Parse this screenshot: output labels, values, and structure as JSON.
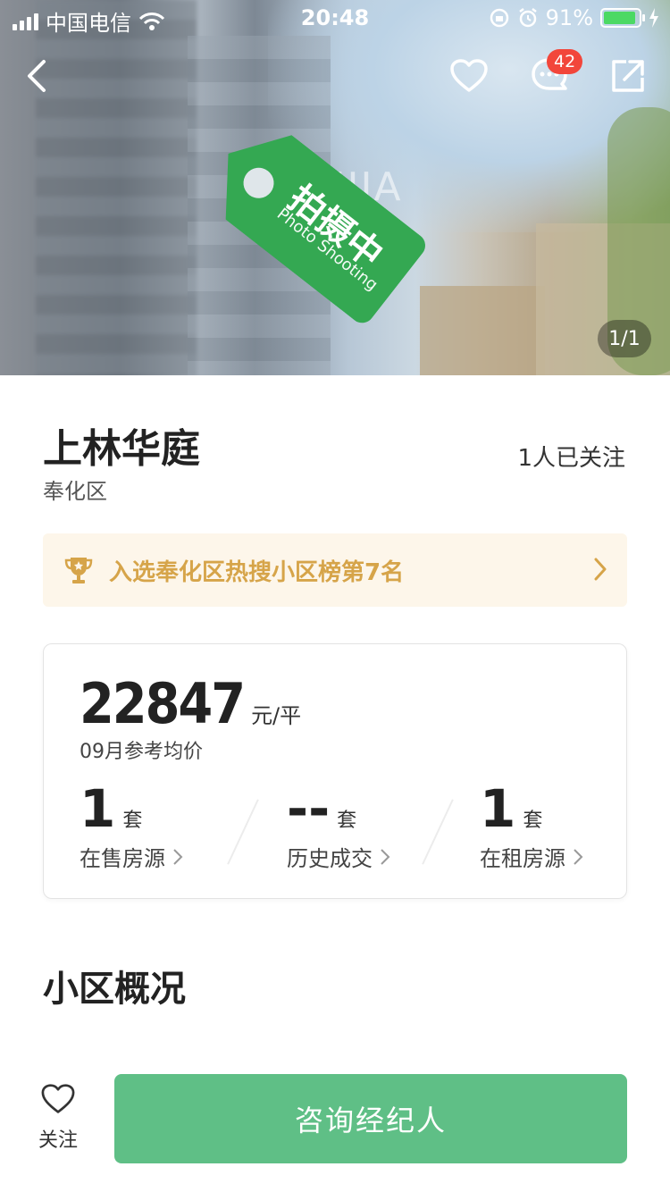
{
  "status_bar": {
    "carrier": "中国电信",
    "time": "20:48",
    "battery": "91%"
  },
  "hero": {
    "watermark": "LIANJIA",
    "tag_text": "拍摄中",
    "tag_sub": "Photo Shooting",
    "image_counter": "1/1",
    "message_badge": "42"
  },
  "property": {
    "name": "上林华庭",
    "district": "奉化区",
    "follow_count": "1人已关注"
  },
  "rank_banner": {
    "text": "入选奉化区热搜小区榜第7名"
  },
  "price_card": {
    "price": "22847",
    "price_unit": "元/平",
    "price_label": "09月参考均价",
    "stats": [
      {
        "value": "1",
        "unit": "套",
        "label": "在售房源"
      },
      {
        "value": "--",
        "unit": "套",
        "label": "历史成交"
      },
      {
        "value": "1",
        "unit": "套",
        "label": "在租房源"
      }
    ]
  },
  "section": {
    "title": "小区概况"
  },
  "bottom_bar": {
    "follow_label": "关注",
    "consult_label": "咨询经纪人"
  },
  "colors": {
    "accent_green": "#5fbf86",
    "badge_red": "#f2463b",
    "rank_gold": "#d6a449",
    "tag_green": "#34a852"
  }
}
